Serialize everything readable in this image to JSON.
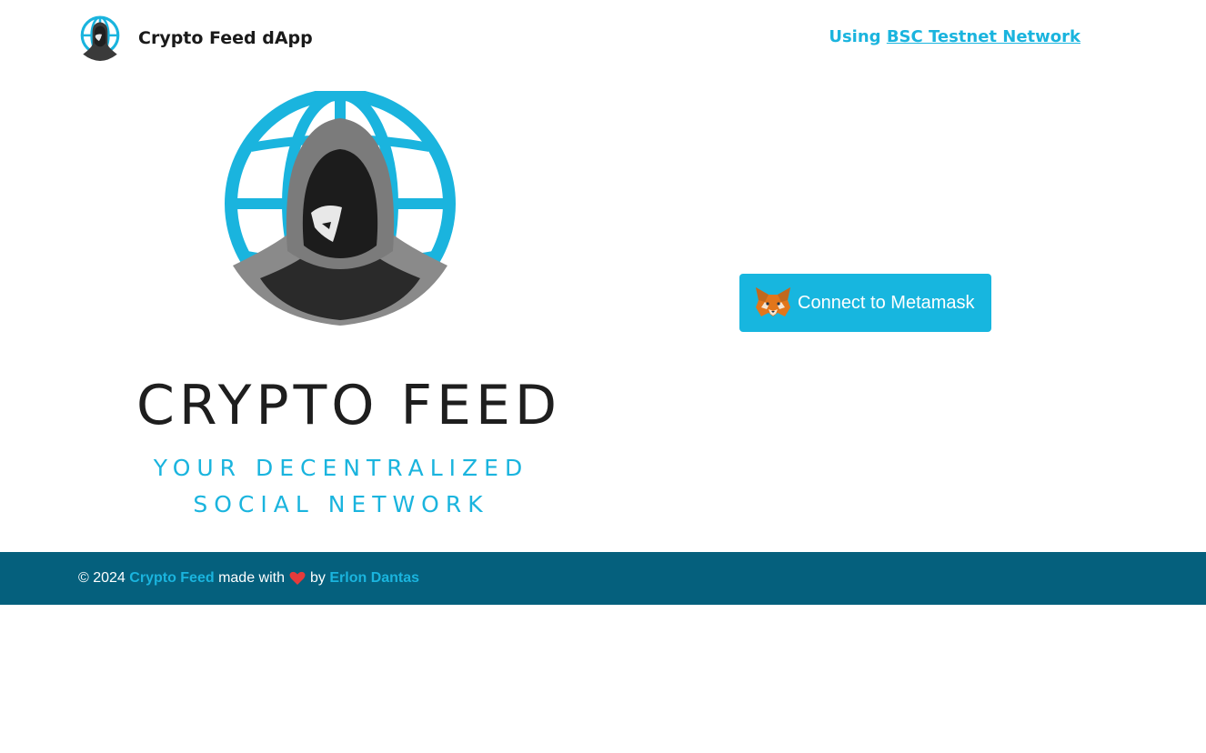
{
  "header": {
    "brand_title": "Crypto Feed dApp",
    "network_prefix": "Using ",
    "network_link": "BSC Testnet Network"
  },
  "hero": {
    "title": "CRYPTO FEED",
    "subtitle_line1": "YOUR DECENTRALIZED",
    "subtitle_line2": "SOCIAL NETWORK"
  },
  "connect": {
    "label": "Connect to Metamask",
    "icon": "metamask-fox-icon"
  },
  "footer": {
    "copyright": "© 2024",
    "app_name": "Crypto Feed",
    "made_with": "made with",
    "heart_icon": "heart-icon",
    "by": "by",
    "author": "Erlon Dantas"
  },
  "colors": {
    "accent": "#1ab4de",
    "button": "#17b6df",
    "footer_bg": "#05607d",
    "heart": "#e53b3b"
  }
}
